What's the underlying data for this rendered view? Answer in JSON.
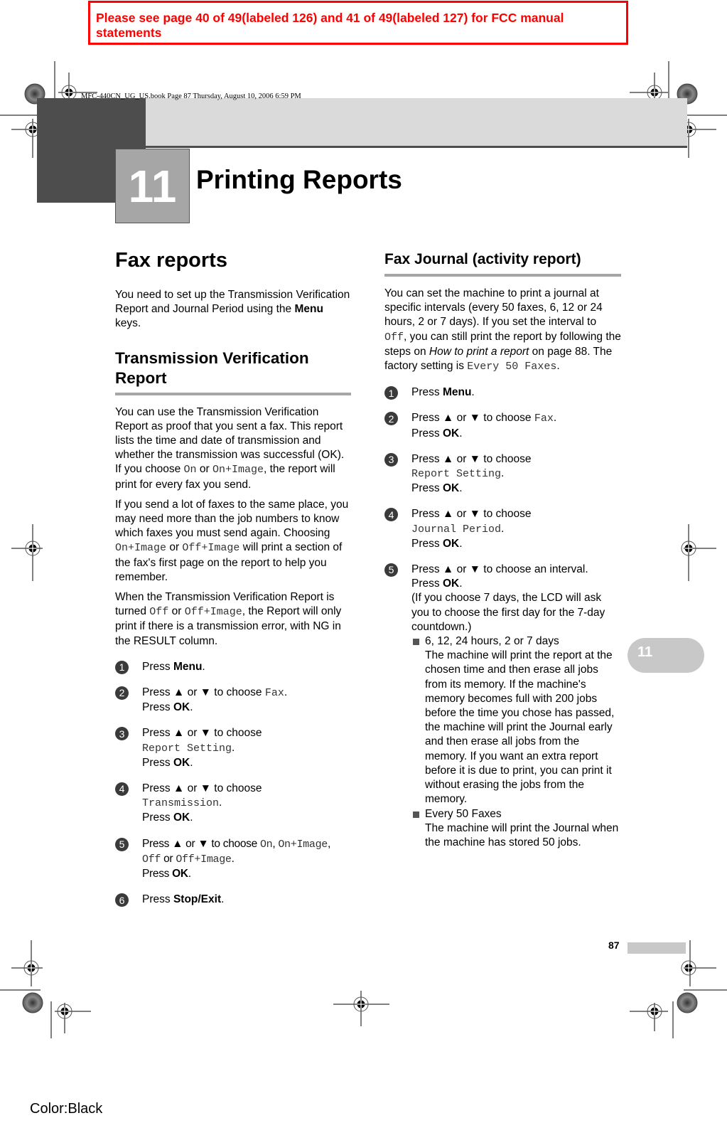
{
  "notice": {
    "text": "Please see page 40 of 49(labeled 126) and 41 of 49(labeled 127) for FCC manual statements",
    "color": "#ff0000"
  },
  "header": {
    "book_meta": "MFC-440CN_UG_US.book  Page 87  Thursday, August 10, 2006  6:59 PM",
    "chapter_number": "11",
    "chapter_title": "Printing Reports"
  },
  "left_column": {
    "section_title": "Fax reports",
    "intro": {
      "before": "You need to set up the Transmission Verification Report and Journal Period using the ",
      "bold": "Menu",
      "after": " keys."
    },
    "subsection_title": "Transmission Verification Report",
    "para1": {
      "before": "You can use the Transmission Verification Report as proof that you sent a fax. This report lists the time and date of transmission and whether the transmission was successful (OK). If you choose ",
      "code1": "On",
      "mid": " or ",
      "code2": "On+Image",
      "after": ", the report will print for every fax you send."
    },
    "para2": {
      "before": "If you send a lot of faxes to the same place, you may need more than the job numbers to know which faxes you must send again. Choosing ",
      "code1": "On+Image",
      "mid": " or ",
      "code2": "Off+Image",
      "after": " will print a section of the fax's first page on the report to help you remember."
    },
    "para3": {
      "before": "When the Transmission Verification Report is turned ",
      "code1": "Off",
      "mid": " or ",
      "code2": "Off+Image",
      "after": ", the Report will only print if there is a transmission error, with NG in the RESULT column."
    },
    "steps": [
      {
        "num": "1",
        "press": "Press ",
        "key": "Menu",
        "end": "."
      },
      {
        "num": "2",
        "choose": "Press ▲ or ▼ to choose ",
        "code": "Fax",
        "end": ".",
        "ok_prefix": "Press ",
        "ok": "OK",
        "ok_end": "."
      },
      {
        "num": "3",
        "choose": "Press ▲ or ▼ to choose",
        "code": "Report Setting",
        "end": ".",
        "ok_prefix": "Press ",
        "ok": "OK",
        "ok_end": "."
      },
      {
        "num": "4",
        "choose": "Press ▲ or ▼ to choose",
        "code": "Transmission",
        "end": ".",
        "ok_prefix": "Press ",
        "ok": "OK",
        "ok_end": "."
      },
      {
        "num": "5",
        "choose": "Press ▲ or ▼ to choose ",
        "codes": [
          "On",
          "On+Image",
          "Off",
          "Off+Image"
        ],
        "sep1": ", ",
        "sep2": ",",
        "sep3": " or ",
        "end": ".",
        "ok_prefix": "Press ",
        "ok": "OK",
        "ok_end": "."
      },
      {
        "num": "6",
        "press": "Press ",
        "key": "Stop/Exit",
        "end": "."
      }
    ]
  },
  "right_column": {
    "subsection_title": "Fax Journal (activity report)",
    "intro": {
      "before": "You can set the machine to print a journal at specific intervals (every 50 faxes, 6, 12 or 24 hours, 2 or 7 days). If you set the interval to ",
      "code1": "Off",
      "mid": ", you can still print the report by following the steps on ",
      "italic": "How to print a report",
      "mid2": " on page 88. The factory setting is ",
      "code2": "Every 50 Faxes",
      "after": "."
    },
    "steps": [
      {
        "num": "1",
        "press": "Press ",
        "key": "Menu",
        "end": "."
      },
      {
        "num": "2",
        "choose": "Press ▲ or ▼ to choose ",
        "code": "Fax",
        "end": ".",
        "ok_prefix": "Press ",
        "ok": "OK",
        "ok_end": "."
      },
      {
        "num": "3",
        "choose": "Press ▲ or ▼ to choose",
        "code": "Report Setting",
        "end": ".",
        "ok_prefix": "Press ",
        "ok": "OK",
        "ok_end": "."
      },
      {
        "num": "4",
        "choose": "Press ▲ or ▼ to choose",
        "code": "Journal Period",
        "end": ".",
        "ok_prefix": "Press ",
        "ok": "OK",
        "ok_end": "."
      },
      {
        "num": "5",
        "choose": "Press ▲ or ▼ to choose an interval.",
        "ok_prefix": "Press ",
        "ok": "OK",
        "ok_end": ".",
        "note": "(If you choose 7 days, the LCD will ask you to choose the first day for the 7-day countdown.)"
      }
    ],
    "bullets": [
      {
        "title": "6, 12, 24 hours, 2 or 7 days",
        "text": "The machine will print the report at the chosen time and then erase all jobs from its memory. If the machine's memory becomes full with 200 jobs before the time you chose has passed, the machine will print the Journal early and then erase all jobs from the memory. If you want an extra report before it is due to print, you can print it without erasing the jobs from the memory."
      },
      {
        "title": "Every 50 Faxes",
        "text": "The machine will print the Journal when the machine has stored 50 jobs."
      }
    ]
  },
  "side_tab": {
    "label": "11"
  },
  "footer": {
    "page_number": "87",
    "color_label": "Color:Black"
  }
}
